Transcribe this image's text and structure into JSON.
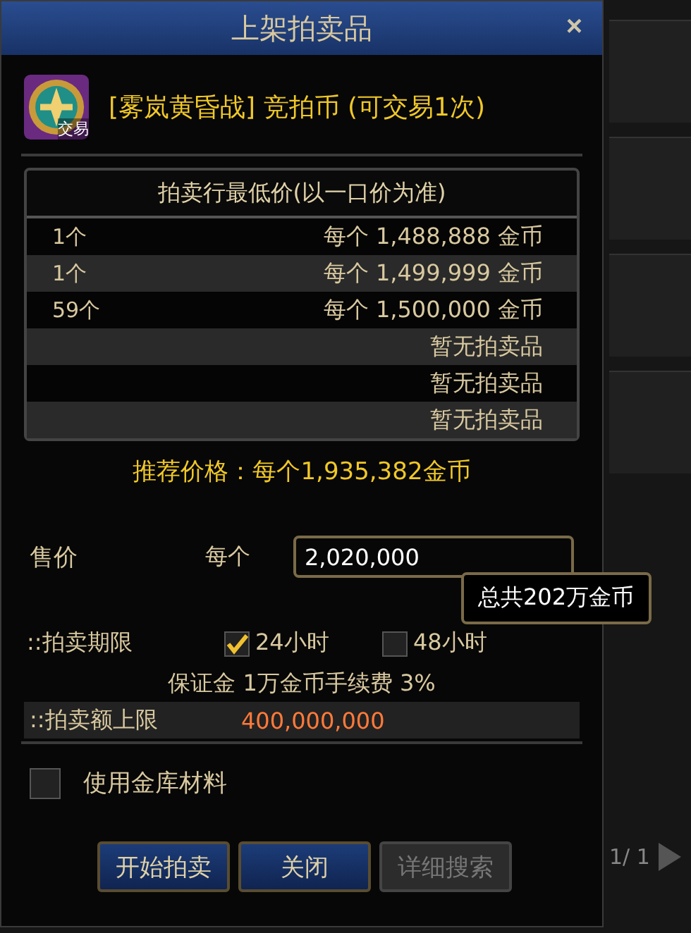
{
  "window": {
    "title": "上架拍卖品",
    "close": "×"
  },
  "item": {
    "badge": "交易",
    "name": "[雾岚黄昏战] 竞拍币 (可交易1次)"
  },
  "lowest_prices": {
    "title": "拍卖行最低价(以一口价为准)",
    "rows": [
      {
        "kind": "listing",
        "quantity": "1个",
        "per": "每个",
        "price": "1,488,888",
        "currency": "金币"
      },
      {
        "kind": "listing",
        "quantity": "1个",
        "per": "每个",
        "price": "1,499,999",
        "currency": "金币"
      },
      {
        "kind": "listing",
        "quantity": "59个",
        "per": "每个",
        "price": "1,500,000",
        "currency": "金币"
      },
      {
        "kind": "empty",
        "text": "暂无拍卖品"
      },
      {
        "kind": "empty",
        "text": "暂无拍卖品"
      },
      {
        "kind": "empty",
        "text": "暂无拍卖品"
      }
    ]
  },
  "recommended": "推荐价格：每个1,935,382金币",
  "price": {
    "label": "售价",
    "per": "每个",
    "value": "2,020,000",
    "tooltip": "总共202万金币"
  },
  "duration": {
    "label": "::拍卖期限",
    "options": [
      {
        "label": "24小时",
        "selected": true
      },
      {
        "label": "48小时",
        "selected": false
      }
    ]
  },
  "fees": "保证金 1万金币手续费 3%",
  "limit": {
    "label": "::拍卖额上限",
    "value": "400,000,000"
  },
  "use_vault": {
    "label": "使用金库材料",
    "checked": false
  },
  "buttons": [
    {
      "label": "开始拍卖",
      "disabled": false
    },
    {
      "label": "关闭",
      "disabled": false
    },
    {
      "label": "详细搜索",
      "disabled": true
    }
  ],
  "background": {
    "page": "1/ 1"
  }
}
